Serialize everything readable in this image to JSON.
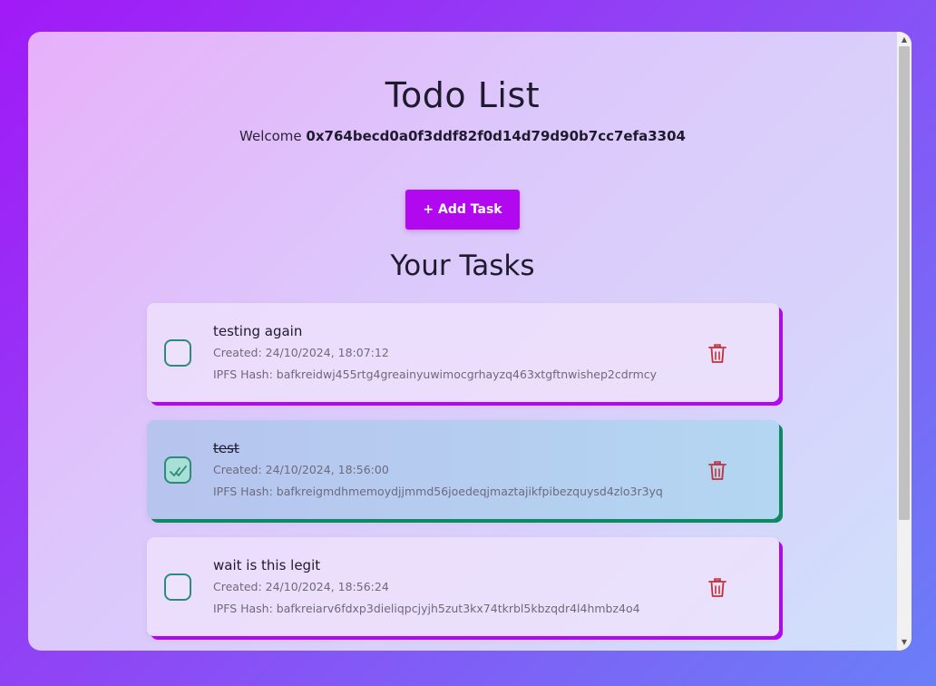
{
  "header": {
    "title": "Todo List",
    "welcome_prefix": "Welcome",
    "wallet_address": "0x764becd0a0f3ddf82f0d14d79d90b7cc7efa3304"
  },
  "actions": {
    "add_task_label": "+ Add Task"
  },
  "tasks_section": {
    "heading": "Your Tasks",
    "tasks": [
      {
        "title": "testing again",
        "created": "Created: 24/10/2024, 18:07:12",
        "ipfs": "IPFS Hash: bafkreidwj455rtg4greainyuwimocgrhayzq463xtgftnwishep2cdrmcy",
        "completed": false
      },
      {
        "title": "test",
        "created": "Created: 24/10/2024, 18:56:00",
        "ipfs": "IPFS Hash: bafkreigmdhmemoydjjmmd56joedeqjmaztajikfpibezquysd4zlo3r3yq",
        "completed": true
      },
      {
        "title": "wait is this legit",
        "created": "Created: 24/10/2024, 18:56:24",
        "ipfs": "IPFS Hash: bafkreiarv6fdxp3dieliqpcjyjh5zut3kx74tkrbl5kbzqdr4l4hmbz4o4",
        "completed": false
      }
    ]
  },
  "colors": {
    "accent": "#b208f0",
    "completed_border": "#0e8a62",
    "checkbox": "#2e8a7a",
    "delete": "#c0323a"
  },
  "icons": {
    "checkbox_checked": "double-check-icon",
    "delete": "trash-icon"
  }
}
